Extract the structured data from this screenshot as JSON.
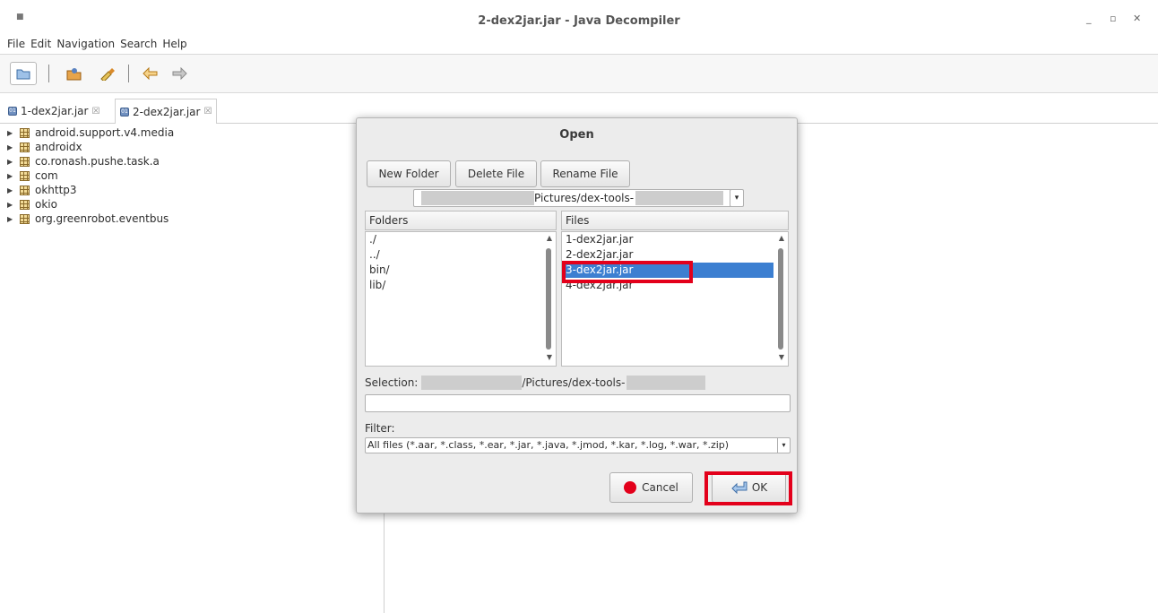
{
  "window": {
    "title": "2-dex2jar.jar - Java Decompiler",
    "app_icon": "java-decompiler-icon"
  },
  "menu": [
    "File",
    "Edit",
    "Navigation",
    "Search",
    "Help"
  ],
  "tabs": [
    {
      "label": "1-dex2jar.jar",
      "close": "☒"
    },
    {
      "label": "2-dex2jar.jar",
      "close": "☒"
    }
  ],
  "tree": [
    "android.support.v4.media",
    "androidx",
    "co.ronash.pushe.task.a",
    "com",
    "okhttp3",
    "okio",
    "org.greenrobot.eventbus"
  ],
  "dialog": {
    "title": "Open",
    "buttons": {
      "new_folder": "New Folder",
      "delete_file": "Delete File",
      "rename_file": "Rename File",
      "cancel": "Cancel",
      "ok": "OK"
    },
    "path": "Pictures/dex-tools-",
    "folders_header": "Folders",
    "files_header": "Files",
    "folders": [
      "./",
      "../",
      "bin/",
      "lib/"
    ],
    "files": [
      "1-dex2jar.jar",
      "2-dex2jar.jar",
      "3-dex2jar.jar",
      "4-dex2jar.jar"
    ],
    "selected_file": "3-dex2jar.jar",
    "selection_label": "Selection:",
    "selection_path": "/Pictures/dex-tools-",
    "selection_value": "",
    "filter_label": "Filter:",
    "filter_value": "All files (*.aar, *.class, *.ear, *.jar, *.java, *.jmod, *.kar, *.log, *.war, *.zip)"
  },
  "colors": {
    "selection": "#3c7fd1",
    "highlight": "#e3001b",
    "cancel_icon": "#e3001b"
  }
}
